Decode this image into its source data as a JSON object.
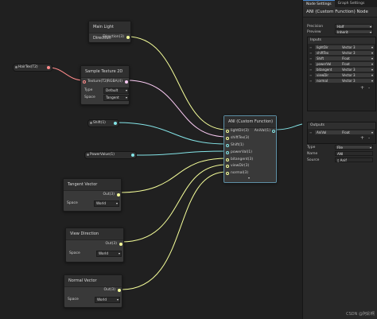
{
  "inspector": {
    "tabs": [
      "Node Settings",
      "Graph Settings"
    ],
    "node_title": "ANI (Custom Function) Node",
    "precision_label": "Precision",
    "precision_value": "Half",
    "preview_label": "Preview",
    "preview_value": "Inherit",
    "inputs_header": "Inputs",
    "inputs": [
      {
        "name": "lightDir",
        "type": "Vector 3"
      },
      {
        "name": "shiftTex",
        "type": "Vector 3"
      },
      {
        "name": "Shift",
        "type": "Float"
      },
      {
        "name": "powerVal",
        "type": "Float"
      },
      {
        "name": "bitangent",
        "type": "Vector 3"
      },
      {
        "name": "viewDir",
        "type": "Vector 3"
      },
      {
        "name": "normal",
        "type": "Vector 3"
      }
    ],
    "outputs_header": "Outputs",
    "outputs": [
      {
        "name": "AniVal",
        "type": "Float"
      }
    ],
    "type_label": "Type",
    "type_value": "File",
    "name_label": "Name",
    "name_value": "ANI",
    "source_label": "Source",
    "source_value": "Anif",
    "plus": "+",
    "minus": "-"
  },
  "graph": {
    "main_light": {
      "title": "Main Light Direction",
      "out": "Direction(3)"
    },
    "hair_tex": {
      "label": "HairTex(T2)"
    },
    "sample_tex": {
      "title": "Sample Texture 2D",
      "in_texture": "Texture(T2)",
      "out_rgba": "RGBA(4)",
      "type_label": "Type",
      "type_value": "Default",
      "space_label": "Space",
      "space_value": "Tangent"
    },
    "shift": {
      "label": "Shift(1)"
    },
    "power": {
      "label": "PowerValue(1)"
    },
    "tangent": {
      "title": "Tangent Vector",
      "out": "Out(3)",
      "space_label": "Space",
      "space_value": "World"
    },
    "view": {
      "title": "View Direction",
      "out": "Out(3)",
      "space_label": "Space",
      "space_value": "World"
    },
    "normal": {
      "title": "Normal Vector",
      "out": "Out(3)",
      "space_label": "Space",
      "space_value": "World"
    },
    "ani": {
      "title": "ANI (Custom Function)",
      "inputs": [
        "lightDir(3)",
        "shiftTex(3)",
        "Shift(1)",
        "powerVal(1)",
        "bitangent(3)",
        "viewDir(3)",
        "normal(3)"
      ],
      "out": "AniVal(1)"
    }
  },
  "watermark": "CSDN @阿彩啊",
  "colors": {
    "vector3": "#f6ff9a",
    "float": "#84e4e7",
    "texture": "#ff8b8b",
    "vector4": "#fbcbf4",
    "accent": "#4a8ad0"
  }
}
